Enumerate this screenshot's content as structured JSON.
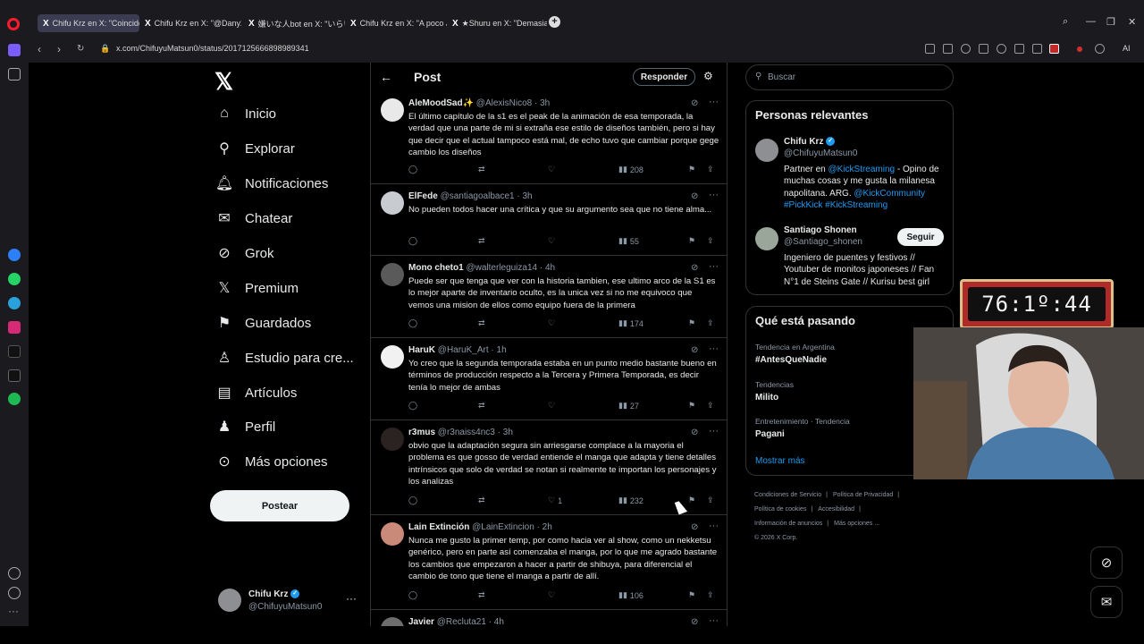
{
  "browser": {
    "tabs": [
      {
        "title": "Chifu Krz en X: \"Coincido",
        "active": true
      },
      {
        "title": "Chifu Krz en X: \"@Dany21"
      },
      {
        "title": "嫌いな人bot en X: \"いらいら"
      },
      {
        "title": "Chifu Krz en X: \"A poco Ju"
      },
      {
        "title": "★Shuru en X: \"Demasiado"
      }
    ],
    "new_tab": "+",
    "url": "x.com/ChifuyuMatsun0/status/2017125666898989341",
    "ai_label": "AI"
  },
  "nav": {
    "items": [
      {
        "label": "Inicio",
        "icon": "home-icon"
      },
      {
        "label": "Explorar",
        "icon": "search-icon"
      },
      {
        "label": "Notificaciones",
        "icon": "bell-icon"
      },
      {
        "label": "Chatear",
        "icon": "envelope-icon"
      },
      {
        "label": "Grok",
        "icon": "grok-icon"
      },
      {
        "label": "Premium",
        "icon": "x-icon"
      },
      {
        "label": "Guardados",
        "icon": "bookmark-icon"
      },
      {
        "label": "Estudio para cre...",
        "icon": "studio-icon"
      },
      {
        "label": "Artículos",
        "icon": "article-icon"
      },
      {
        "label": "Perfil",
        "icon": "person-icon"
      },
      {
        "label": "Más opciones",
        "icon": "more-circle-icon"
      }
    ],
    "post_button": "Postear",
    "account": {
      "name": "Chifu Krz",
      "handle": "@ChifuyuMatsun0",
      "more": "···"
    }
  },
  "main": {
    "title": "Post",
    "reply_button": "Responder",
    "tweets": [
      {
        "name": "AleMoodSad✨",
        "handle": "@AlexisNico8",
        "time": "3h",
        "text": "El último capítulo de la s1 es el peak de la animación de esa temporada, la verdad que una parte de mi si extraña ese estilo de diseños también, pero si hay que decir que el actual tampoco está mal, de echo tuvo que cambiar porque gege cambio los diseños",
        "likes": "",
        "views": "208"
      },
      {
        "name": "ElFede",
        "handle": "@santiagoalbace1",
        "time": "3h",
        "text": "No pueden todos hacer una crítica y que su argumento sea que no tiene alma...",
        "likes": "",
        "views": "55"
      },
      {
        "name": "Mono cheto1",
        "handle": "@walterleguiza14",
        "time": "4h",
        "text": "Puede ser que tenga que ver con la historia tambien, ese ultimo arco de la S1 es lo mejor aparte de inventario oculto, es la unica vez si no me equivoco que vemos una mision de ellos como equipo fuera de la primera",
        "likes": "",
        "views": "174"
      },
      {
        "name": "HaruK",
        "handle": "@HaruK_Art",
        "time": "1h",
        "text": "Yo creo que la segunda temporada estaba en un punto medio bastante bueno en términos de producción respecto a la Tercera y Primera Temporada, es decir tenía lo mejor de ambas",
        "likes": "",
        "views": "27"
      },
      {
        "name": "r3mus",
        "handle": "@r3naiss4nc3",
        "time": "3h",
        "text": "obvio que la adaptación segura sin arriesgarse complace a la mayoria el problema es que gosso de verdad entiende el manga que adapta y tiene detalles intrínsicos que solo de verdad se notan si realmente te importan los personajes y los analizas",
        "likes": "1",
        "views": "232"
      },
      {
        "name": "Lain Extinción",
        "handle": "@LainExtincion",
        "time": "2h",
        "text": "Nunca me gusto la primer temp, por como hacia ver al show, como un nekketsu genérico, pero en parte así comenzaba el manga, por lo que me agrado bastante los cambios que empezaron a hacer a partir de shibuya, para diferencial el cambio de tono que tiene el manga a partir de allí.",
        "likes": "",
        "views": "106"
      },
      {
        "name": "Javier",
        "handle": "@Recluta21",
        "time": "4h",
        "text": "",
        "likes": "",
        "views": ""
      }
    ]
  },
  "right": {
    "search_placeholder": "Buscar",
    "relevant": {
      "title": "Personas relevantes",
      "people": [
        {
          "name": "Chifu Krz",
          "handle": "@ChifuyuMatsun0",
          "verified": true,
          "bio_parts": [
            {
              "t": "Partner en ",
              "link": false
            },
            {
              "t": "@KickStreaming",
              "link": true
            },
            {
              "t": " - Opino de muchas cosas y me gusta la milanesa napolitana. ARG. ",
              "link": false
            },
            {
              "t": "@KickCommunity",
              "link": true
            },
            {
              "t": " ",
              "link": false
            },
            {
              "t": "#PickKick",
              "link": true
            },
            {
              "t": " ",
              "link": false
            },
            {
              "t": "#KickStreaming",
              "link": true
            }
          ]
        },
        {
          "name": "Santiago Shonen",
          "handle": "@Santiago_shonen",
          "follow": "Seguir",
          "bio": "Ingeniero de puentes y festivos // Youtuber de monitos japoneses // Fan N°1 de Steins Gate // Kurisu best girl"
        }
      ]
    },
    "trends": {
      "title": "Qué está pasando",
      "items": [
        {
          "context": "Tendencia en Argentina",
          "name": "#AntesQueNadie"
        },
        {
          "context": "Tendencias",
          "name": "Milito"
        },
        {
          "context": "Entretenimiento · Tendencia",
          "name": "Pagani"
        }
      ],
      "show_more": "Mostrar más"
    },
    "footer": {
      "links": [
        "Condiciones de Servicio",
        "Política de Privacidad",
        "Política de cookies",
        "Accesibilidad",
        "Información de anuncios",
        "Más opciones ..."
      ],
      "copyright": "© 2026 X Corp."
    }
  },
  "overlay": {
    "timer": "76:1º:44"
  },
  "colors": {
    "accent": "#1d9bf0",
    "background": "#000000",
    "text": "#e7e9ea",
    "muted": "#8b98a5",
    "border": "#2f3336"
  }
}
